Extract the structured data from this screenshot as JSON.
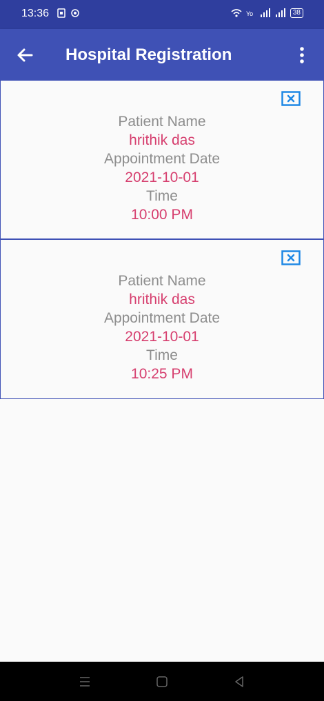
{
  "status_bar": {
    "time": "13:36",
    "battery": "38"
  },
  "app_bar": {
    "title": "Hospital Registration"
  },
  "appointments": [
    {
      "name_label": "Patient Name",
      "name": "hrithik das",
      "date_label": "Appointment Date",
      "date": "2021-10-01",
      "time_label": "Time",
      "time": "10:00 PM"
    },
    {
      "name_label": "Patient Name",
      "name": "hrithik das",
      "date_label": "Appointment Date",
      "date": "2021-10-01",
      "time_label": "Time",
      "time": "10:25 PM"
    }
  ],
  "colors": {
    "app_bar": "#3f51b5",
    "status_bar": "#2f3e9e",
    "value_text": "#d63e6e",
    "label_text": "#8d8d8d",
    "close_icon": "#1e88e5"
  },
  "icons": [
    "back-arrow-icon",
    "more-vert-icon",
    "close-box-icon",
    "nav-menu-icon",
    "nav-home-icon",
    "nav-back-icon"
  ]
}
